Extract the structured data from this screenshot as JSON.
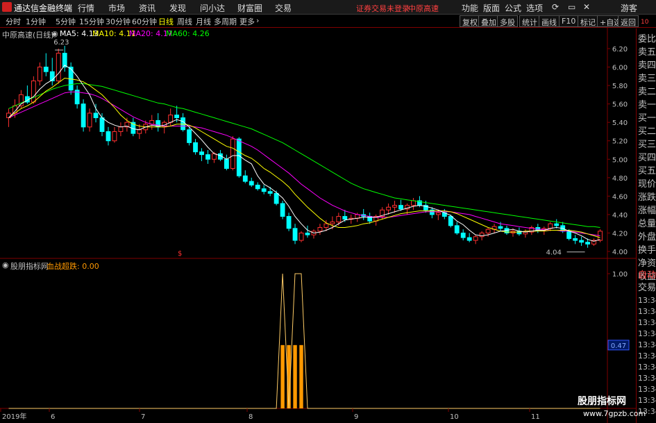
{
  "menubar": {
    "app_title": "通达信金融终端",
    "items": [
      "行情",
      "市场",
      "资讯",
      "发现",
      "问小达",
      "财富圈",
      "交易"
    ],
    "warning": "证券交易未登录",
    "stock_tag": "中原高速",
    "right_items": [
      "功能",
      "版面",
      "公式",
      "选项"
    ],
    "guest": "游客"
  },
  "toolbar": {
    "periods": [
      "分时",
      "1分钟",
      "5分钟",
      "15分钟",
      "30分钟",
      "60分钟",
      "日线",
      "周线",
      "月线",
      "多周期",
      "更多"
    ],
    "active_period": "日线",
    "right_buttons": [
      "复权",
      "叠加",
      "多股",
      "统计",
      "画线",
      "F10",
      "标记",
      "+自选",
      "返回"
    ]
  },
  "legend": {
    "stock": "中原高速(日线)",
    "ma5": "MA5: 4.13",
    "ma10": "MA10: 4.11",
    "ma20": "MA20: 4.17",
    "ma60": "MA60: 4.26",
    "colors": {
      "ma5": "#ffffff",
      "ma10": "#ffff00",
      "ma20": "#ff00ff",
      "ma60": "#00ff00"
    }
  },
  "indicator": {
    "name": "股朋指标网",
    "line_label": "血战超跌: 0.00",
    "y_ticks": [
      "1.00",
      "0.47"
    ],
    "current_value": "0.47"
  },
  "sidepanel": {
    "items": [
      "委比",
      "卖五",
      "卖四",
      "卖三",
      "卖二",
      "卖一",
      "买一",
      "买二",
      "买三",
      "买四",
      "买五",
      "现价",
      "涨跌",
      "涨幅",
      "总量",
      "外盘",
      "换手",
      "净资",
      "收益"
    ],
    "tabs": [
      "自动",
      "交易"
    ],
    "times": [
      "13:34",
      "13:34",
      "13:34",
      "13:34",
      "13:34",
      "13:34",
      "13:34",
      "13:34",
      "13:34",
      "13:34",
      "13:34"
    ],
    "top_badge": "10"
  },
  "watermark": {
    "title": "股朋指标网",
    "url": "www.7gpzb.com"
  },
  "chart_data": {
    "type": "candlestick",
    "price_axis": {
      "min": 4.0,
      "max": 6.2,
      "ticks": [
        "6.20",
        "6.00",
        "5.80",
        "5.60",
        "5.40",
        "5.20",
        "5.00",
        "4.80",
        "4.60",
        "4.40",
        "4.20",
        "4.00"
      ]
    },
    "annotations": {
      "high_label": "6.23",
      "low_label": "4.04",
      "marker": "$"
    },
    "x_labels": [
      "2019年",
      "6",
      "7",
      "8",
      "9",
      "10",
      "11"
    ],
    "candles": [
      [
        5.45,
        5.55,
        5.35,
        5.5
      ],
      [
        5.5,
        5.65,
        5.45,
        5.58
      ],
      [
        5.58,
        5.75,
        5.55,
        5.7
      ],
      [
        5.68,
        5.8,
        5.6,
        5.62
      ],
      [
        5.62,
        5.9,
        5.6,
        5.85
      ],
      [
        5.85,
        6.05,
        5.8,
        6.0
      ],
      [
        6.0,
        6.15,
        5.9,
        5.95
      ],
      [
        5.95,
        6.1,
        5.8,
        5.85
      ],
      [
        5.85,
        6.2,
        5.82,
        6.15
      ],
      [
        6.15,
        6.23,
        5.95,
        6.0
      ],
      [
        6.0,
        6.05,
        5.7,
        5.75
      ],
      [
        5.75,
        5.8,
        5.55,
        5.6
      ],
      [
        5.6,
        5.65,
        5.3,
        5.35
      ],
      [
        5.35,
        5.55,
        5.3,
        5.5
      ],
      [
        5.5,
        5.6,
        5.4,
        5.45
      ],
      [
        5.45,
        5.5,
        5.25,
        5.3
      ],
      [
        5.3,
        5.35,
        5.15,
        5.2
      ],
      [
        5.2,
        5.35,
        5.18,
        5.3
      ],
      [
        5.3,
        5.4,
        5.25,
        5.35
      ],
      [
        5.35,
        5.45,
        5.3,
        5.4
      ],
      [
        5.4,
        5.45,
        5.25,
        5.28
      ],
      [
        5.28,
        5.38,
        5.22,
        5.32
      ],
      [
        5.32,
        5.42,
        5.28,
        5.38
      ],
      [
        5.38,
        5.48,
        5.32,
        5.42
      ],
      [
        5.42,
        5.5,
        5.3,
        5.35
      ],
      [
        5.35,
        5.42,
        5.28,
        5.4
      ],
      [
        5.4,
        5.55,
        5.36,
        5.48
      ],
      [
        5.48,
        5.58,
        5.4,
        5.45
      ],
      [
        5.45,
        5.5,
        5.3,
        5.32
      ],
      [
        5.32,
        5.35,
        5.15,
        5.18
      ],
      [
        5.18,
        5.22,
        5.05,
        5.08
      ],
      [
        5.08,
        5.12,
        4.98,
        5.05
      ],
      [
        5.05,
        5.1,
        4.95,
        5.0
      ],
      [
        5.0,
        5.08,
        4.96,
        5.06
      ],
      [
        5.06,
        5.1,
        4.98,
        5.0
      ],
      [
        5.0,
        5.05,
        4.88,
        4.9
      ],
      [
        4.9,
        5.25,
        4.88,
        5.22
      ],
      [
        5.22,
        5.24,
        4.8,
        4.82
      ],
      [
        4.82,
        4.88,
        4.74,
        4.76
      ],
      [
        4.76,
        4.8,
        4.7,
        4.72
      ],
      [
        4.72,
        4.75,
        4.66,
        4.68
      ],
      [
        4.68,
        4.72,
        4.62,
        4.65
      ],
      [
        4.65,
        4.7,
        4.6,
        4.63
      ],
      [
        4.63,
        4.66,
        4.5,
        4.52
      ],
      [
        4.52,
        4.55,
        4.35,
        4.38
      ],
      [
        4.38,
        4.42,
        4.22,
        4.25
      ],
      [
        4.25,
        4.3,
        4.08,
        4.12
      ],
      [
        4.12,
        4.22,
        4.1,
        4.2
      ],
      [
        4.2,
        4.28,
        4.15,
        4.18
      ],
      [
        4.18,
        4.24,
        4.14,
        4.22
      ],
      [
        4.22,
        4.3,
        4.18,
        4.26
      ],
      [
        4.26,
        4.34,
        4.22,
        4.3
      ],
      [
        4.3,
        4.38,
        4.24,
        4.32
      ],
      [
        4.32,
        4.42,
        4.28,
        4.38
      ],
      [
        4.38,
        4.45,
        4.32,
        4.35
      ],
      [
        4.35,
        4.4,
        4.3,
        4.36
      ],
      [
        4.36,
        4.42,
        4.32,
        4.4
      ],
      [
        4.4,
        4.46,
        4.34,
        4.38
      ],
      [
        4.38,
        4.42,
        4.3,
        4.33
      ],
      [
        4.33,
        4.4,
        4.28,
        4.38
      ],
      [
        4.38,
        4.48,
        4.35,
        4.45
      ],
      [
        4.45,
        4.52,
        4.4,
        4.48
      ],
      [
        4.48,
        4.55,
        4.42,
        4.5
      ],
      [
        4.5,
        4.56,
        4.44,
        4.46
      ],
      [
        4.46,
        4.52,
        4.4,
        4.5
      ],
      [
        4.5,
        4.58,
        4.45,
        4.55
      ],
      [
        4.55,
        4.6,
        4.48,
        4.5
      ],
      [
        4.5,
        4.55,
        4.42,
        4.45
      ],
      [
        4.45,
        4.48,
        4.36,
        4.4
      ],
      [
        4.4,
        4.45,
        4.34,
        4.42
      ],
      [
        4.42,
        4.46,
        4.35,
        4.38
      ],
      [
        4.38,
        4.4,
        4.26,
        4.28
      ],
      [
        4.28,
        4.32,
        4.18,
        4.2
      ],
      [
        4.2,
        4.24,
        4.12,
        4.15
      ],
      [
        4.15,
        4.2,
        4.1,
        4.12
      ],
      [
        4.12,
        4.18,
        4.08,
        4.16
      ],
      [
        4.16,
        4.22,
        4.12,
        4.2
      ],
      [
        4.2,
        4.26,
        4.16,
        4.24
      ],
      [
        4.24,
        4.3,
        4.2,
        4.27
      ],
      [
        4.27,
        4.32,
        4.22,
        4.25
      ],
      [
        4.25,
        4.28,
        4.18,
        4.2
      ],
      [
        4.2,
        4.25,
        4.16,
        4.22
      ],
      [
        4.22,
        4.26,
        4.17,
        4.19
      ],
      [
        4.19,
        4.24,
        4.15,
        4.21
      ],
      [
        4.21,
        4.28,
        4.18,
        4.26
      ],
      [
        4.26,
        4.3,
        4.2,
        4.23
      ],
      [
        4.23,
        4.27,
        4.18,
        4.25
      ],
      [
        4.25,
        4.32,
        4.22,
        4.3
      ],
      [
        4.3,
        4.35,
        4.25,
        4.28
      ],
      [
        4.28,
        4.32,
        4.2,
        4.22
      ],
      [
        4.22,
        4.24,
        4.12,
        4.14
      ],
      [
        4.14,
        4.18,
        4.08,
        4.12
      ],
      [
        4.12,
        4.16,
        4.06,
        4.1
      ],
      [
        4.1,
        4.14,
        4.04,
        4.08
      ],
      [
        4.08,
        4.14,
        4.06,
        4.12
      ],
      [
        4.12,
        4.24,
        4.1,
        4.22
      ]
    ],
    "ma5": [
      5.45,
      5.52,
      5.6,
      5.64,
      5.68,
      5.76,
      5.82,
      5.86,
      5.93,
      6.02,
      5.98,
      5.9,
      5.8,
      5.7,
      5.55,
      5.45,
      5.4,
      5.37,
      5.35,
      5.36,
      5.33,
      5.32,
      5.35,
      5.37,
      5.36,
      5.37,
      5.4,
      5.43,
      5.41,
      5.35,
      5.28,
      5.21,
      5.13,
      5.06,
      5.04,
      5.0,
      5.04,
      5.04,
      4.99,
      4.95,
      4.82,
      4.73,
      4.69,
      4.64,
      4.58,
      4.49,
      4.38,
      4.3,
      4.23,
      4.2,
      4.21,
      4.23,
      4.26,
      4.3,
      4.34,
      4.35,
      4.36,
      4.37,
      4.37,
      4.37,
      4.39,
      4.41,
      4.43,
      4.45,
      4.47,
      4.49,
      4.5,
      4.49,
      4.47,
      4.45,
      4.42,
      4.39,
      4.33,
      4.29,
      4.23,
      4.18,
      4.17,
      4.18,
      4.2,
      4.22,
      4.23,
      4.24,
      4.22,
      4.21,
      4.22,
      4.23,
      4.23,
      4.25,
      4.26,
      4.25,
      4.22,
      4.2,
      4.17,
      4.13,
      4.11,
      4.13
    ],
    "ma10": [
      5.45,
      5.5,
      5.55,
      5.58,
      5.62,
      5.68,
      5.74,
      5.78,
      5.83,
      5.88,
      5.87,
      5.86,
      5.84,
      5.8,
      5.75,
      5.7,
      5.63,
      5.56,
      5.48,
      5.42,
      5.38,
      5.36,
      5.35,
      5.35,
      5.35,
      5.35,
      5.36,
      5.38,
      5.38,
      5.37,
      5.34,
      5.3,
      5.26,
      5.22,
      5.18,
      5.14,
      5.12,
      5.08,
      5.04,
      5.01,
      4.96,
      4.9,
      4.86,
      4.81,
      4.76,
      4.7,
      4.62,
      4.55,
      4.48,
      4.42,
      4.36,
      4.31,
      4.28,
      4.26,
      4.26,
      4.27,
      4.28,
      4.3,
      4.31,
      4.33,
      4.35,
      4.37,
      4.39,
      4.41,
      4.42,
      4.43,
      4.44,
      4.44,
      4.44,
      4.44,
      4.44,
      4.43,
      4.41,
      4.38,
      4.35,
      4.32,
      4.29,
      4.26,
      4.24,
      4.22,
      4.21,
      4.21,
      4.21,
      4.22,
      4.22,
      4.22,
      4.22,
      4.23,
      4.23,
      4.23,
      4.23,
      4.22,
      4.21,
      4.19,
      4.17,
      4.15
    ],
    "ma20": [
      5.45,
      5.48,
      5.51,
      5.54,
      5.57,
      5.6,
      5.63,
      5.66,
      5.69,
      5.72,
      5.73,
      5.73,
      5.72,
      5.71,
      5.69,
      5.66,
      5.62,
      5.58,
      5.54,
      5.5,
      5.46,
      5.43,
      5.4,
      5.38,
      5.37,
      5.36,
      5.36,
      5.36,
      5.36,
      5.36,
      5.35,
      5.34,
      5.32,
      5.3,
      5.28,
      5.26,
      5.23,
      5.2,
      5.17,
      5.14,
      5.1,
      5.05,
      5.0,
      4.95,
      4.9,
      4.85,
      4.79,
      4.73,
      4.68,
      4.63,
      4.58,
      4.54,
      4.5,
      4.47,
      4.44,
      4.42,
      4.4,
      4.39,
      4.38,
      4.37,
      4.37,
      4.37,
      4.38,
      4.39,
      4.4,
      4.41,
      4.42,
      4.43,
      4.43,
      4.43,
      4.43,
      4.43,
      4.42,
      4.41,
      4.4,
      4.38,
      4.36,
      4.34,
      4.32,
      4.3,
      4.29,
      4.28,
      4.27,
      4.26,
      4.25,
      4.24,
      4.24,
      4.23,
      4.23,
      4.22,
      4.22,
      4.21,
      4.2,
      4.19,
      4.18,
      4.17
    ],
    "ma60": [
      5.55,
      5.58,
      5.61,
      5.64,
      5.67,
      5.7,
      5.73,
      5.76,
      5.78,
      5.8,
      5.81,
      5.82,
      5.82,
      5.81,
      5.8,
      5.79,
      5.77,
      5.75,
      5.73,
      5.71,
      5.69,
      5.67,
      5.65,
      5.63,
      5.61,
      5.6,
      5.58,
      5.56,
      5.55,
      5.53,
      5.51,
      5.49,
      5.47,
      5.45,
      5.43,
      5.41,
      5.39,
      5.37,
      5.35,
      5.33,
      5.3,
      5.27,
      5.24,
      5.21,
      5.18,
      5.14,
      5.1,
      5.06,
      5.02,
      4.98,
      4.94,
      4.9,
      4.86,
      4.82,
      4.78,
      4.74,
      4.71,
      4.68,
      4.66,
      4.64,
      4.62,
      4.6,
      4.58,
      4.57,
      4.56,
      4.55,
      4.54,
      4.53,
      4.52,
      4.51,
      4.5,
      4.49,
      4.48,
      4.47,
      4.46,
      4.45,
      4.44,
      4.43,
      4.42,
      4.41,
      4.4,
      4.39,
      4.38,
      4.37,
      4.36,
      4.35,
      4.34,
      4.33,
      4.32,
      4.31,
      4.3,
      4.29,
      4.28,
      4.27,
      4.27,
      4.26
    ],
    "indicator_series": {
      "peaks": [
        {
          "index": 44,
          "value": 1.0
        },
        {
          "index": 46,
          "value": 1.0
        },
        {
          "index": 47,
          "value": 1.0
        }
      ],
      "bars": [
        {
          "index": 44,
          "value": 0.47
        },
        {
          "index": 45,
          "value": 0.47
        },
        {
          "index": 46,
          "value": 0.47
        },
        {
          "index": 47,
          "value": 0.47
        }
      ]
    }
  }
}
